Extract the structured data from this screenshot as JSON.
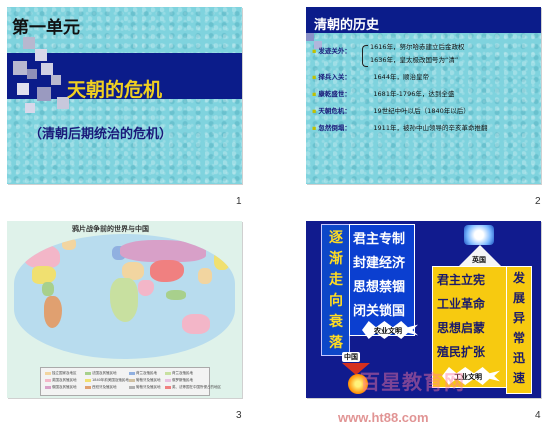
{
  "slides": [
    {
      "number": "1",
      "title": "第一单元",
      "main": "天朝的危机",
      "sub": "（清朝后期统治的危机）"
    },
    {
      "number": "2",
      "title": "清朝的历史",
      "rows": [
        {
          "label": "发迹关外：",
          "lines": [
            "1616年，努尔哈赤建立后金政权",
            "1636年，皇太极改国号为“清”"
          ]
        },
        {
          "label": "择兵入关：",
          "lines": [
            "1644年，顺治皇帝"
          ]
        },
        {
          "label": "康乾盛世：",
          "lines": [
            "1681年-1796年，达到全盛"
          ]
        },
        {
          "label": "天朝危机：",
          "lines": [
            "19世纪中叶以后（1840年以后）"
          ]
        },
        {
          "label": "忽然倒塌：",
          "lines": [
            "1911年，被孙中山领导的辛亥革命推翻"
          ]
        }
      ]
    },
    {
      "number": "3",
      "map_title": "鸦片战争前的世界与中国",
      "legend": [
        {
          "label": "独立国家及地区",
          "color": "#f2d5a0"
        },
        {
          "label": "英国及其殖民地",
          "color": "#f3b6c8"
        },
        {
          "label": "俄国及其殖民地",
          "color": "#d8a0c8"
        },
        {
          "label": "法国及其殖民地",
          "color": "#a8d08c"
        },
        {
          "label": "1840年前美国及殖民地",
          "color": "#f0e070"
        },
        {
          "label": "西班牙及殖民地",
          "color": "#e0a070"
        },
        {
          "label": "荷兰及殖民地",
          "color": "#90b0e0"
        },
        {
          "label": "葡萄牙及殖民地",
          "color": "#d0c0a0"
        },
        {
          "label": "葡萄牙及殖民地",
          "color": "#b0b0b0"
        },
        {
          "label": "荷兰及殖民地",
          "color": "#c8e0a0"
        },
        {
          "label": "俄罗斯殖民地",
          "color": "#e8c0e0"
        },
        {
          "label": "英、法等国在中国所侵占的地区",
          "color": "#f08080"
        }
      ]
    },
    {
      "number": "4",
      "left_vertical": [
        "逐",
        "渐",
        "走",
        "向",
        "衰",
        "落"
      ],
      "center": [
        "君主专制",
        "封建经济",
        "思想禁锢",
        "闭关锁国"
      ],
      "nongye": "农业文明",
      "china": "中国",
      "britain": "英国",
      "right": [
        "君主立宪",
        "工业革命",
        "思想启蒙",
        "殖民扩张"
      ],
      "gongye": "工业文明",
      "right_vertical": [
        "发",
        "展",
        "异",
        "常",
        "迅",
        "速"
      ]
    }
  ],
  "watermark": {
    "cn": "百星教育网",
    "url": "www.ht88.com"
  },
  "colors": {
    "navy": "#0b1c8a",
    "aqua": "#7fd3de",
    "gold": "#f7ca10",
    "title_yellow": "#f0d020"
  }
}
